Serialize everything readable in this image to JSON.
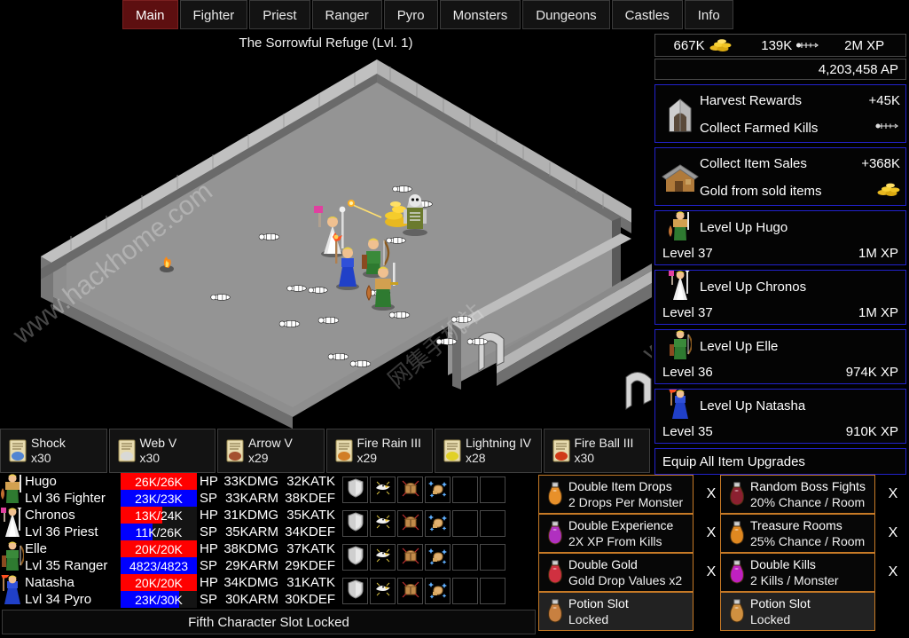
{
  "tabs": [
    {
      "label": "Main",
      "active": true
    },
    {
      "label": "Fighter",
      "active": false
    },
    {
      "label": "Priest",
      "active": false
    },
    {
      "label": "Ranger",
      "active": false
    },
    {
      "label": "Pyro",
      "active": false
    },
    {
      "label": "Monsters",
      "active": false
    },
    {
      "label": "Dungeons",
      "active": false
    },
    {
      "label": "Castles",
      "active": false
    },
    {
      "label": "Info",
      "active": false
    }
  ],
  "dungeon": {
    "title": "The Sorrowful Refuge (Lvl. 1)",
    "watermarks": [
      "www.hackhome.com",
      "www.hackhome.com",
      "网集手机站"
    ]
  },
  "resources": {
    "gold": "667K",
    "gold_icon": "gold-coins-icon",
    "kills": "139K",
    "kills_icon": "skeleton-bones-icon",
    "xp": "2M XP",
    "ap": "4,203,458 AP"
  },
  "rewards": [
    {
      "icon": "stone-tomb-icon",
      "title": "Harvest Rewards",
      "amount": "+45K",
      "subtitle": "Collect Farmed Kills",
      "sub_icon": "skeleton-bones-icon"
    },
    {
      "icon": "house-icon",
      "title": "Collect Item Sales",
      "amount": "+368K",
      "subtitle": "Gold from sold items",
      "sub_icon": "gold-coins-icon"
    }
  ],
  "levelups": [
    {
      "icon": "fighter-portrait-icon",
      "title": "Level Up Hugo",
      "level": "Level 37",
      "xp": "1M XP"
    },
    {
      "icon": "priest-portrait-icon",
      "title": "Level Up Chronos",
      "level": "Level 37",
      "xp": "1M XP"
    },
    {
      "icon": "ranger-portrait-icon",
      "title": "Level Up Elle",
      "level": "Level 36",
      "xp": "974K XP"
    },
    {
      "icon": "pyro-portrait-icon",
      "title": "Level Up Natasha",
      "level": "Level 35",
      "xp": "910K XP"
    }
  ],
  "equip_all": "Equip All Item Upgrades",
  "spells": [
    {
      "name": "Shock",
      "qty": "x30",
      "icon": "scroll-shock-icon",
      "glyph_color": "#4a7fd4"
    },
    {
      "name": "Web V",
      "qty": "x30",
      "icon": "scroll-web-icon",
      "glyph_color": "#d8d8d8"
    },
    {
      "name": "Arrow V",
      "qty": "x29",
      "icon": "scroll-arrow-icon",
      "glyph_color": "#a04828"
    },
    {
      "name": "Fire Rain III",
      "qty": "x29",
      "icon": "scroll-firerain-icon",
      "glyph_color": "#d07820"
    },
    {
      "name": "Lightning IV",
      "qty": "x28",
      "icon": "scroll-lightning-icon",
      "glyph_color": "#e0d020"
    },
    {
      "name": "Fire Ball III",
      "qty": "x30",
      "icon": "scroll-fireball-icon",
      "glyph_color": "#d03010"
    }
  ],
  "characters": [
    {
      "portrait": "fighter-portrait-icon",
      "name": "Hugo",
      "class_line": "Lvl 36 Fighter",
      "hp_text": "26K/26K",
      "hp_pct": 100,
      "sp_text": "23K/23K",
      "sp_pct": 100,
      "hp_label": "HP",
      "sp_label": "SP",
      "dmg": "33KDMG",
      "arm": "33KARM",
      "atk": "32KATK",
      "def": "38KDEF",
      "slots": [
        "shield-icon",
        "eagle-icon",
        "chest-icon",
        "muscle-icon",
        "empty-slot",
        "empty-slot"
      ]
    },
    {
      "portrait": "priest-portrait-icon",
      "name": "Chronos",
      "class_line": "Lvl 36 Priest",
      "hp_text": "13K/24K",
      "hp_pct": 55,
      "sp_text": "11K/26K",
      "sp_pct": 42,
      "hp_label": "HP",
      "sp_label": "SP",
      "dmg": "31KDMG",
      "arm": "35KARM",
      "atk": "35KATK",
      "def": "34KDEF",
      "slots": [
        "shield-icon",
        "eagle-icon",
        "chest-icon",
        "muscle-icon",
        "empty-slot",
        "empty-slot"
      ]
    },
    {
      "portrait": "ranger-portrait-icon",
      "name": "Elle",
      "class_line": "Lvl 35 Ranger",
      "hp_text": "20K/20K",
      "hp_pct": 100,
      "sp_text": "4823/4823",
      "sp_pct": 100,
      "hp_label": "HP",
      "sp_label": "SP",
      "dmg": "38KDMG",
      "arm": "29KARM",
      "atk": "37KATK",
      "def": "29KDEF",
      "slots": [
        "shield-icon",
        "eagle-icon",
        "chest-icon",
        "muscle-icon",
        "empty-slot",
        "empty-slot"
      ]
    },
    {
      "portrait": "pyro-portrait-icon",
      "name": "Natasha",
      "class_line": "Lvl 34 Pyro",
      "hp_text": "20K/20K",
      "hp_pct": 100,
      "sp_text": "23K/30K",
      "sp_pct": 77,
      "hp_label": "HP",
      "sp_label": "SP",
      "dmg": "34KDMG",
      "arm": "30KARM",
      "atk": "31KATK",
      "def": "30KDEF",
      "slots": [
        "shield-icon",
        "eagle-icon",
        "chest-icon",
        "muscle-icon",
        "empty-slot",
        "empty-slot"
      ]
    }
  ],
  "locked_slot_text": "Fifth Character Slot Locked",
  "bonuses_left": [
    {
      "icon": "potion-orange-icon",
      "color": "#e8902a",
      "line1": "Double Item Drops",
      "line2": "2 Drops Per Monster",
      "locked": false,
      "close": "X"
    },
    {
      "icon": "potion-purple-icon",
      "color": "#b030c0",
      "line1": "Double Experience",
      "line2": "2X XP From Kills",
      "locked": false,
      "close": "X"
    },
    {
      "icon": "potion-red-icon",
      "color": "#d03040",
      "line1": "Double Gold",
      "line2": "Gold Drop Values x2",
      "locked": false,
      "close": "X"
    },
    {
      "icon": "potion-orange-icon",
      "color": "#c88040",
      "line1": "Potion Slot",
      "line2": "Locked",
      "locked": true,
      "close": ""
    }
  ],
  "bonuses_right": [
    {
      "icon": "potion-darkred-icon",
      "color": "#8b2030",
      "line1": "Random Boss Fights",
      "line2": "20% Chance / Room",
      "locked": false,
      "close": "X"
    },
    {
      "icon": "potion-orange-icon",
      "color": "#e08820",
      "line1": "Treasure Rooms",
      "line2": "25% Chance / Room",
      "locked": false,
      "close": "X"
    },
    {
      "icon": "potion-magenta-icon",
      "color": "#c020c0",
      "line1": "Double Kills",
      "line2": "2 Kills / Monster",
      "locked": false,
      "close": "X"
    },
    {
      "icon": "potion-orange-icon",
      "color": "#d09040",
      "line1": "Potion Slot",
      "line2": "Locked",
      "locked": true,
      "close": ""
    }
  ],
  "colors": {
    "active_tab": "#5d0f10",
    "card_border": "#2222cc",
    "bonus_border": "#c77a26",
    "hp": "#ff0000",
    "sp": "#0000ff"
  }
}
